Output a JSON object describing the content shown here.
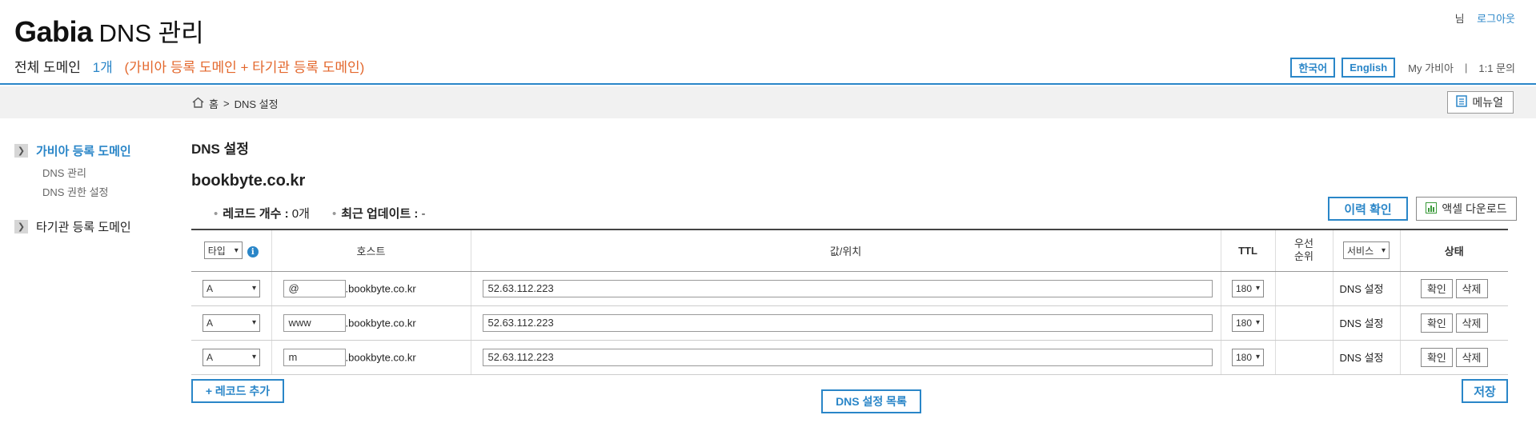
{
  "header": {
    "brand_main": "Gabia",
    "brand_sub": "DNS 관리",
    "all_domains_label": "전체 도메인",
    "domain_count": "1개",
    "domain_desc": "(가비아 등록 도메인 + 타기관 등록 도메인)"
  },
  "topnav": {
    "user_suffix": "님",
    "logout": "로그아웃"
  },
  "utilbar": {
    "korean": "한국어",
    "english": "English",
    "my_gabia": "My 가비아",
    "divider": "|",
    "inquiry": "1:1 문의"
  },
  "breadcrumb": {
    "home": "홈",
    "separator": ">",
    "current": "DNS 설정"
  },
  "manual_button": "메뉴얼",
  "sidebar": {
    "gabia_group": "가비아 등록 도메인",
    "gabia_items": [
      "DNS 관리",
      "DNS 권한 설정"
    ],
    "other_group": "타기관 등록 도메인"
  },
  "main": {
    "section_title": "DNS 설정",
    "domain": "bookbyte.co.kr",
    "record_count_label": "레코드 개수 :",
    "record_count_value": "0개",
    "last_update_label": "최근 업데이트 :",
    "last_update_value": "-",
    "history_button": "이력 확인",
    "excel_button": "액셀 다운로드"
  },
  "table": {
    "headers": {
      "type": "타입",
      "host": "호스트",
      "value": "값/위치",
      "ttl": "TTL",
      "priority_line1": "우선",
      "priority_line2": "순위",
      "service": "서비스",
      "status": "상태"
    },
    "rows": [
      {
        "type": "A",
        "host": "@",
        "suffix": ".bookbyte.co.kr",
        "value": "52.63.112.223",
        "ttl": "180",
        "priority": "",
        "status": "DNS 설정",
        "confirm": "확인",
        "delete": "삭제"
      },
      {
        "type": "A",
        "host": "www",
        "suffix": ".bookbyte.co.kr",
        "value": "52.63.112.223",
        "ttl": "180",
        "priority": "",
        "status": "DNS 설정",
        "confirm": "확인",
        "delete": "삭제"
      },
      {
        "type": "A",
        "host": "m",
        "suffix": ".bookbyte.co.kr",
        "value": "52.63.112.223",
        "ttl": "180",
        "priority": "",
        "status": "DNS 설정",
        "confirm": "확인",
        "delete": "삭제"
      }
    ]
  },
  "footer_buttons": {
    "add_record": "+ 레코드 추가",
    "dns_list": "DNS 설정 목록",
    "save": "저장"
  },
  "colors": {
    "accent": "#2a86c8",
    "highlight": "#e3672c"
  },
  "icons": {
    "home": "home-icon",
    "manual": "document-icon",
    "excel": "chart-icon",
    "info": "info-icon",
    "arrow": "chevron-right-icon"
  }
}
